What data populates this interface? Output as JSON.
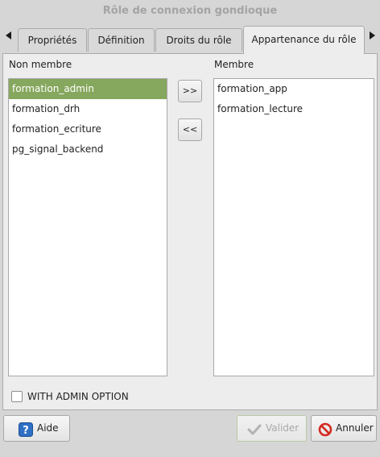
{
  "window": {
    "title": "Rôle de connexion gondioque"
  },
  "tabs": [
    {
      "label": "Propriétés"
    },
    {
      "label": "Définition"
    },
    {
      "label": "Droits du rôle"
    },
    {
      "label": "Appartenance du rôle"
    }
  ],
  "active_tab": "Appartenance du rôle",
  "non_member": {
    "label": "Non membre",
    "items": [
      "formation_admin",
      "formation_drh",
      "formation_ecriture",
      "pg_signal_backend"
    ],
    "selected": "formation_admin"
  },
  "member": {
    "label": "Membre",
    "items": [
      "formation_app",
      "formation_lecture"
    ]
  },
  "move": {
    "add_label": ">>",
    "remove_label": "<<"
  },
  "admin_option": {
    "label": "WITH ADMIN OPTION",
    "checked": false
  },
  "buttons": {
    "help": "Aide",
    "ok": "Valider",
    "cancel": "Annuler"
  },
  "colors": {
    "selection": "#86a75e",
    "help_icon": "#2f6fc4",
    "cancel_icon": "#d42a1f"
  }
}
